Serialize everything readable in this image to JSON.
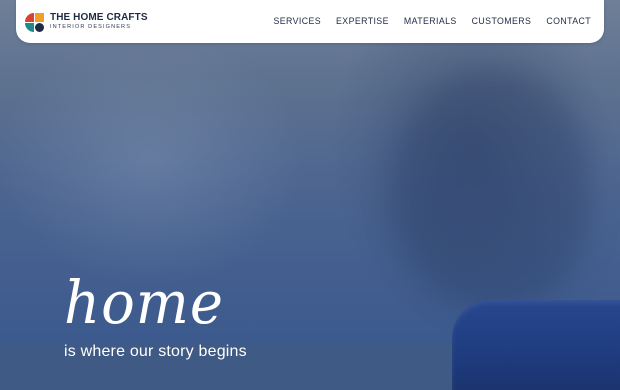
{
  "brand": {
    "name": "THE HOME CRAFTS",
    "tagline": "INTERIOR DESIGNERS",
    "colors": {
      "red": "#d8432e",
      "orange": "#f0a028",
      "teal": "#1f8a8a",
      "navy": "#1f2a44"
    }
  },
  "nav": {
    "items": [
      {
        "label": "SERVICES"
      },
      {
        "label": "EXPERTISE"
      },
      {
        "label": "MATERIALS"
      },
      {
        "label": "CUSTOMERS"
      },
      {
        "label": "CONTACT"
      }
    ]
  },
  "hero": {
    "headline": "home",
    "subheadline": "is where our story begins"
  }
}
